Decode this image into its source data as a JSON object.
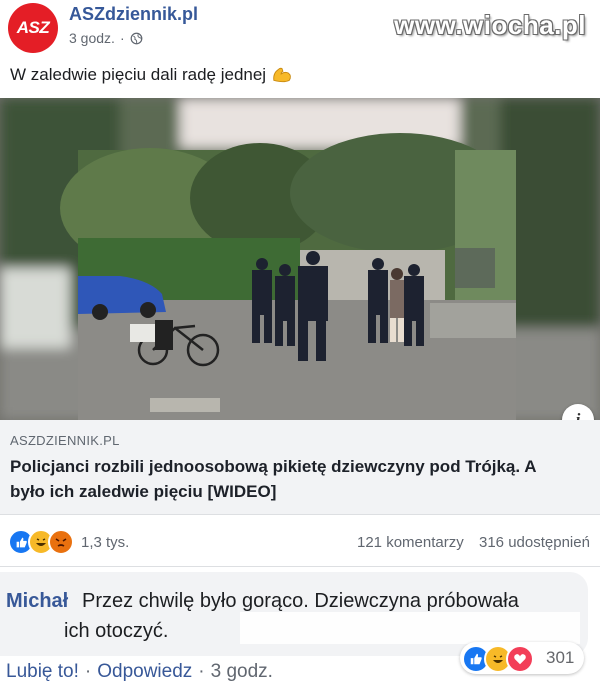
{
  "header": {
    "avatar_text": "ASZ",
    "page_name": "ASZdziennik.pl",
    "time": "3 godz.",
    "separator": "·",
    "privacy_icon": "globe-icon",
    "watermark": "www.wiocha.pl"
  },
  "post": {
    "text": "W zaledwie pięciu dali radę jednej",
    "emoji_icon": "flexed-biceps-icon"
  },
  "link_preview": {
    "domain": "ASZDZIENNIK.PL",
    "title": "Policjanci rozbili jednoosobową pikietę dziewczyny pod Trójką. A było ich zaledwie pięciu [WIDEO]",
    "info_label": "i"
  },
  "stats": {
    "reaction_icons": [
      "like-icon",
      "haha-icon",
      "angry-icon"
    ],
    "reaction_count": "1,3 tys.",
    "comments": "121 komentarzy",
    "shares": "316 udostępnień"
  },
  "comment": {
    "author": "Michał",
    "line1": "Przez chwilę było gorąco. Dziewczyna próbowała",
    "line2": "ich otoczyć.",
    "reaction_icons": [
      "like-icon",
      "haha-icon",
      "love-icon"
    ],
    "reaction_count": "301",
    "actions": {
      "like": "Lubię to!",
      "reply": "Odpowiedz",
      "dot": "·",
      "time": "3 godz."
    }
  },
  "colors": {
    "brand_red": "#e41e26",
    "link_blue": "#365899",
    "like_blue": "#1877f2",
    "haha_yellow": "#f7b928",
    "angry_orange": "#e9710f",
    "love_red": "#f33e58"
  }
}
